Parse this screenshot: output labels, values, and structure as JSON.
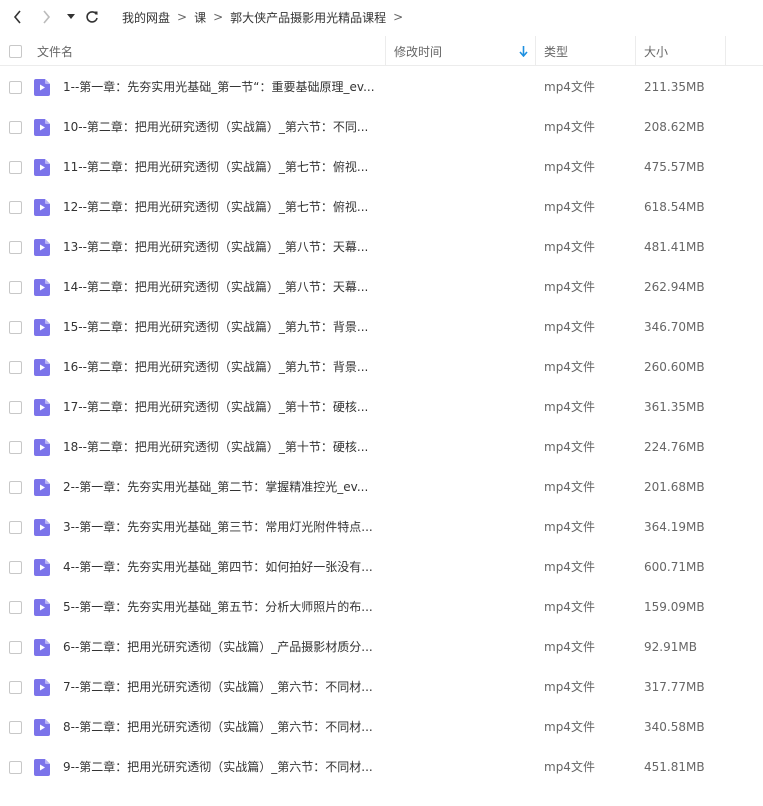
{
  "breadcrumb": [
    "我的网盘",
    "课",
    "郭大侠产品摄影用光精品课程"
  ],
  "breadcrumb_separator": ">",
  "header": {
    "name": "文件名",
    "modified": "修改时间",
    "type": "类型",
    "size": "大小"
  },
  "colors": {
    "accent": "#1e90e0",
    "file_icon": "#7b73ea"
  },
  "files": [
    {
      "name": "1--第一章：先夯实用光基础_第一节“：重要基础原理_ev...",
      "type": "mp4文件",
      "size": "211.35MB"
    },
    {
      "name": "10--第二章：把用光研究透彻（实战篇）_第六节：不同...",
      "type": "mp4文件",
      "size": "208.62MB"
    },
    {
      "name": "11--第二章：把用光研究透彻（实战篇）_第七节：俯视...",
      "type": "mp4文件",
      "size": "475.57MB"
    },
    {
      "name": "12--第二章：把用光研究透彻（实战篇）_第七节：俯视...",
      "type": "mp4文件",
      "size": "618.54MB"
    },
    {
      "name": "13--第二章：把用光研究透彻（实战篇）_第八节：天幕...",
      "type": "mp4文件",
      "size": "481.41MB"
    },
    {
      "name": "14--第二章：把用光研究透彻（实战篇）_第八节：天幕...",
      "type": "mp4文件",
      "size": "262.94MB"
    },
    {
      "name": "15--第二章：把用光研究透彻（实战篇）_第九节：背景...",
      "type": "mp4文件",
      "size": "346.70MB"
    },
    {
      "name": "16--第二章：把用光研究透彻（实战篇）_第九节：背景...",
      "type": "mp4文件",
      "size": "260.60MB"
    },
    {
      "name": "17--第二章：把用光研究透彻（实战篇）_第十节：硬核...",
      "type": "mp4文件",
      "size": "361.35MB"
    },
    {
      "name": "18--第二章：把用光研究透彻（实战篇）_第十节：硬核...",
      "type": "mp4文件",
      "size": "224.76MB"
    },
    {
      "name": "2--第一章：先夯实用光基础_第二节：掌握精准控光_ev...",
      "type": "mp4文件",
      "size": "201.68MB"
    },
    {
      "name": "3--第一章：先夯实用光基础_第三节：常用灯光附件特点...",
      "type": "mp4文件",
      "size": "364.19MB"
    },
    {
      "name": "4--第一章：先夯实用光基础_第四节：如何拍好一张没有...",
      "type": "mp4文件",
      "size": "600.71MB"
    },
    {
      "name": "5--第一章：先夯实用光基础_第五节：分析大师照片的布...",
      "type": "mp4文件",
      "size": "159.09MB"
    },
    {
      "name": "6--第二章：把用光研究透彻（实战篇）_产品摄影材质分...",
      "type": "mp4文件",
      "size": "92.91MB"
    },
    {
      "name": "7--第二章：把用光研究透彻（实战篇）_第六节：不同材...",
      "type": "mp4文件",
      "size": "317.77MB"
    },
    {
      "name": "8--第二章：把用光研究透彻（实战篇）_第六节：不同材...",
      "type": "mp4文件",
      "size": "340.58MB"
    },
    {
      "name": "9--第二章：把用光研究透彻（实战篇）_第六节：不同材...",
      "type": "mp4文件",
      "size": "451.81MB"
    }
  ]
}
